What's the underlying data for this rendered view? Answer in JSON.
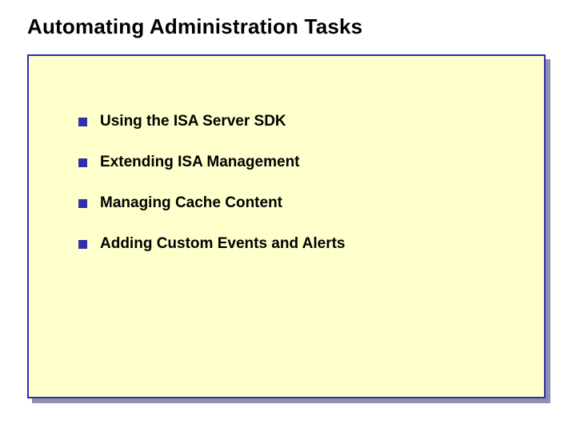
{
  "title": "Automating Administration Tasks",
  "items": [
    {
      "text": "Using the ISA Server SDK"
    },
    {
      "text": "Extending ISA Management"
    },
    {
      "text": "Managing Cache Content"
    },
    {
      "text": "Adding Custom Events and Alerts"
    }
  ]
}
